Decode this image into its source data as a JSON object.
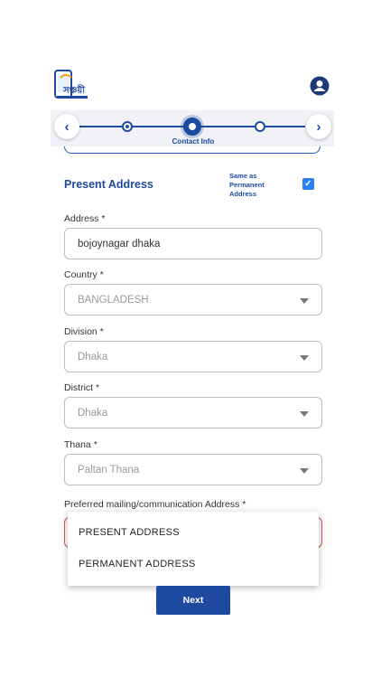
{
  "app": {
    "logo_text": "সঞ্চয়ী",
    "logo_name": "app-logo",
    "avatar_icon": "user-avatar-icon"
  },
  "stepper": {
    "current_label": "Contact Info",
    "prev_icon": "chevron-left-icon",
    "next_icon": "chevron-right-icon",
    "accent": "#1d4aa0"
  },
  "section": {
    "title": "Present Address",
    "same_as_label": "Same as Permanent Address",
    "same_as_checked": true
  },
  "form": {
    "address": {
      "label": "Address *",
      "value": "bojoynagar dhaka"
    },
    "country": {
      "label": "Country *",
      "value": "BANGLADESH"
    },
    "division": {
      "label": "Division *",
      "value": "Dhaka"
    },
    "district": {
      "label": "District *",
      "value": "Dhaka"
    },
    "thana": {
      "label": "Thana *",
      "value": "Paltan Thana"
    },
    "mailing": {
      "label": "Preferred mailing/communication Address *",
      "options": [
        "PRESENT ADDRESS",
        "PERMANENT ADDRESS"
      ]
    }
  },
  "actions": {
    "next_label": "Next"
  }
}
